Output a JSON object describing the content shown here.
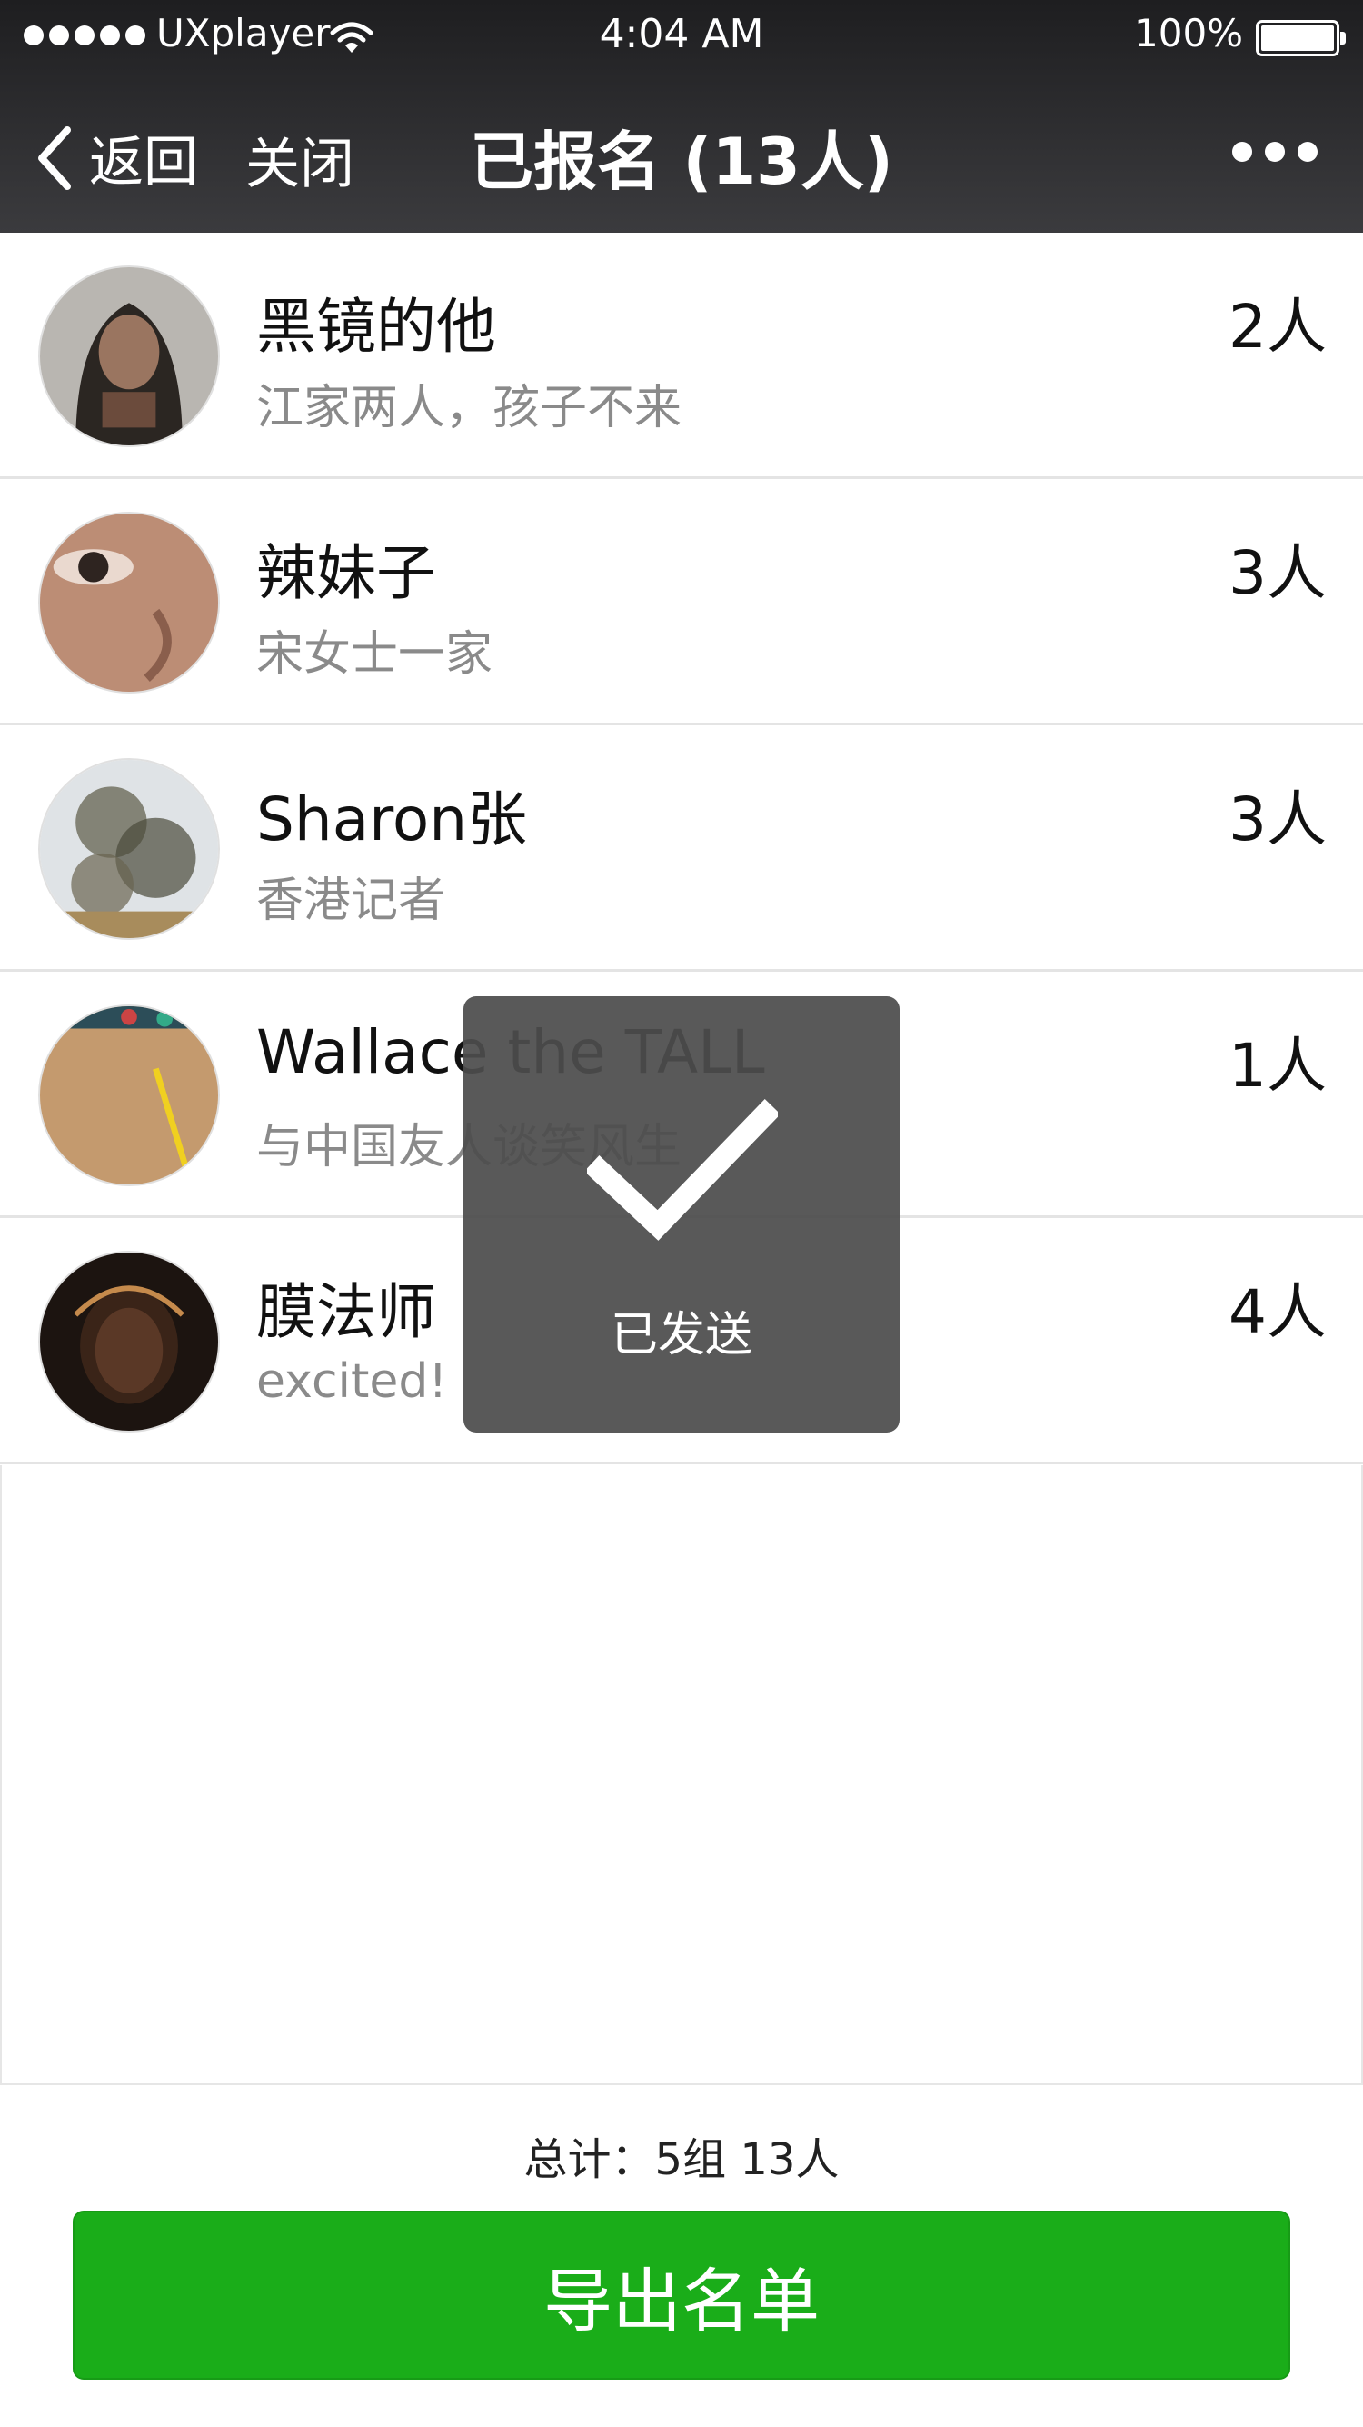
{
  "status_bar": {
    "carrier": "UXplayer",
    "time": "4:04 AM",
    "battery": "100%"
  },
  "nav": {
    "back_label": "返回",
    "close_label": "关闭",
    "title": "已报名 (13人)"
  },
  "list": [
    {
      "name": "黑镜的他",
      "note": "江家两人，孩子不来",
      "count": "2人",
      "avatar": "hooded-boy-photo"
    },
    {
      "name": "辣妹子",
      "note": "宋女士一家",
      "count": "3人",
      "avatar": "eye-closeup-photo"
    },
    {
      "name": "Sharon张",
      "note": "香港记者",
      "count": "3人",
      "avatar": "tree-branches-photo"
    },
    {
      "name": "Wallace the TALL",
      "note": "与中国友人谈笑风生",
      "count": "1人",
      "avatar": "back-with-pencil-photo"
    },
    {
      "name": "膜法师",
      "note": "excited!",
      "count": "4人",
      "avatar": "backlit-girl-photo"
    }
  ],
  "footer": {
    "total": "总计：5组 13人",
    "export_label": "导出名单"
  },
  "toast": {
    "text": "已发送",
    "icon": "checkmark-icon"
  },
  "colors": {
    "nav_bg": "#2b2b2d",
    "primary_button": "#1aad19",
    "note_text": "#8a8a8a"
  }
}
